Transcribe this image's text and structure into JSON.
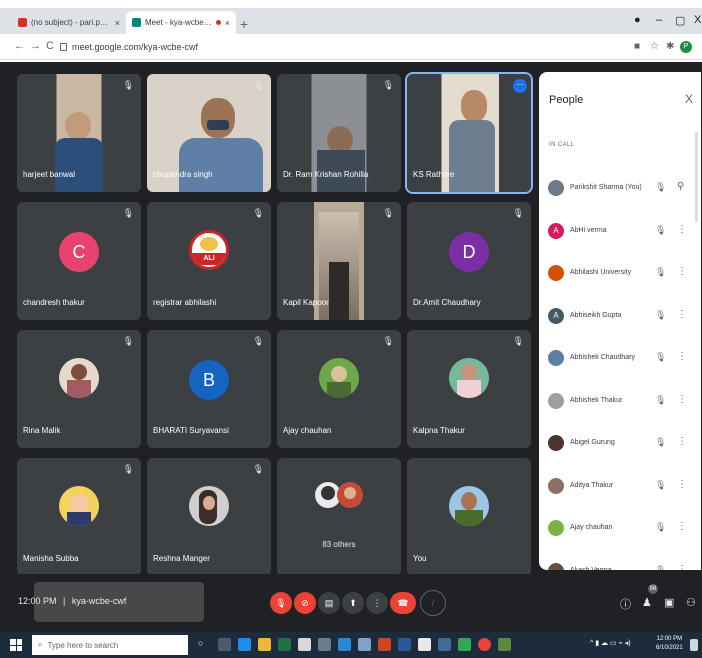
{
  "browser": {
    "tabs": [
      {
        "title": "(no subject) - pari.phy@gmail.c",
        "favicon_color": "#d93025",
        "active": false
      },
      {
        "title": "Meet - kya-wcbe-cwf",
        "favicon_color": "#00897b",
        "active": true
      }
    ],
    "new_tab": "+",
    "tab_close": "×",
    "url": "meet.google.com/kya-wcbe-cwf",
    "nav": {
      "back": "←",
      "forward": "→",
      "reload": "C"
    },
    "profile_initial": "P",
    "window_controls": {
      "minimize": "–",
      "maximize": "▢",
      "close": "X"
    }
  },
  "participants_grid": [
    {
      "name": "harjeet banwal",
      "kind": "video",
      "muted": true,
      "colors": [
        "#c9b8a2",
        "#2b4f7a"
      ]
    },
    {
      "name": "bhupendra singh",
      "kind": "video",
      "muted": true,
      "colors": [
        "#d8d2c8",
        "#3a3a3a"
      ]
    },
    {
      "name": "Dr. Ram Krishan Rohilla",
      "kind": "video",
      "muted": true,
      "colors": [
        "#8c8f94",
        "#3f4a59"
      ]
    },
    {
      "name": "KS Rathore",
      "kind": "video",
      "muted": false,
      "active": true,
      "colors": [
        "#e3dccf",
        "#6d7f8f"
      ]
    },
    {
      "name": "chandresh thakur",
      "kind": "initial",
      "initial": "C",
      "bg": "#e8426e",
      "muted": true
    },
    {
      "name": "registrar abhilashi",
      "kind": "logo",
      "logo_text": "ALI",
      "muted": true
    },
    {
      "name": "Kapil Kapoor",
      "kind": "video",
      "muted": true,
      "colors": [
        "#7d6c60",
        "#2e2a28"
      ]
    },
    {
      "name": "Dr.Amit Chaudhary",
      "kind": "initial",
      "initial": "D",
      "bg": "#7b2fa5",
      "muted": true
    },
    {
      "name": "Rina Malik",
      "kind": "photo",
      "muted": true,
      "colors": [
        "#e6d9c9",
        "#a15c61"
      ]
    },
    {
      "name": "BHARATI Suryavansi",
      "kind": "initial",
      "initial": "B",
      "bg": "#1565c0",
      "muted": true
    },
    {
      "name": "Ajay chauhan",
      "kind": "photo",
      "muted": true,
      "colors": [
        "#6fa84a",
        "#d9c19a"
      ]
    },
    {
      "name": "Kalpna Thakur",
      "kind": "photo",
      "muted": true,
      "colors": [
        "#78b89a",
        "#f1d0d8"
      ]
    },
    {
      "name": "Manisha Subba",
      "kind": "photo",
      "muted": true,
      "colors": [
        "#f3d35a",
        "#2c3b6a"
      ]
    },
    {
      "name": "Reshna Manger",
      "kind": "photo",
      "muted": true,
      "colors": [
        "#cfcfcf",
        "#3b2e2a"
      ]
    },
    {
      "name": "",
      "kind": "others",
      "others_text": "83 others",
      "muted": false
    },
    {
      "name": "You",
      "kind": "photo",
      "muted": false,
      "colors": [
        "#9ac7e8",
        "#4b6b2a"
      ]
    }
  ],
  "people_panel": {
    "title": "People",
    "close": "X",
    "section": "IN CALL",
    "rows": [
      {
        "name": "Parikshit Sharma (You)",
        "avatar": "",
        "bg": "#6d7a88",
        "action": "pin"
      },
      {
        "name": "AbHi verma",
        "avatar": "A",
        "bg": "#d81b60",
        "action": "more"
      },
      {
        "name": "Abhilashi University",
        "avatar": "",
        "bg": "#d35400",
        "action": "more"
      },
      {
        "name": "Abhiseikh Gupta",
        "avatar": "A",
        "bg": "#455a64",
        "action": "more"
      },
      {
        "name": "Abhishek Chaudhary",
        "avatar": "",
        "bg": "#5b7fa6",
        "action": "more"
      },
      {
        "name": "Abhishek Thakur",
        "avatar": "",
        "bg": "#9e9e9e",
        "action": "more"
      },
      {
        "name": "Abigel Gurung",
        "avatar": "",
        "bg": "#4e342e",
        "action": "more"
      },
      {
        "name": "Aditya Thakur",
        "avatar": "",
        "bg": "#8d6e63",
        "action": "more"
      },
      {
        "name": "Ajay chauhan",
        "avatar": "",
        "bg": "#7cb342",
        "action": "more"
      },
      {
        "name": "Akash Verma",
        "avatar": "",
        "bg": "#6d4c41",
        "action": "more"
      }
    ]
  },
  "controls": {
    "time": "12:00 PM",
    "separator": "|",
    "meeting_code": "kya-wcbe-cwf",
    "participant_count": "98"
  },
  "taskbar": {
    "search_placeholder": "Type here to search",
    "clock_time": "12:00 PM",
    "clock_date": "6/10/2021"
  }
}
